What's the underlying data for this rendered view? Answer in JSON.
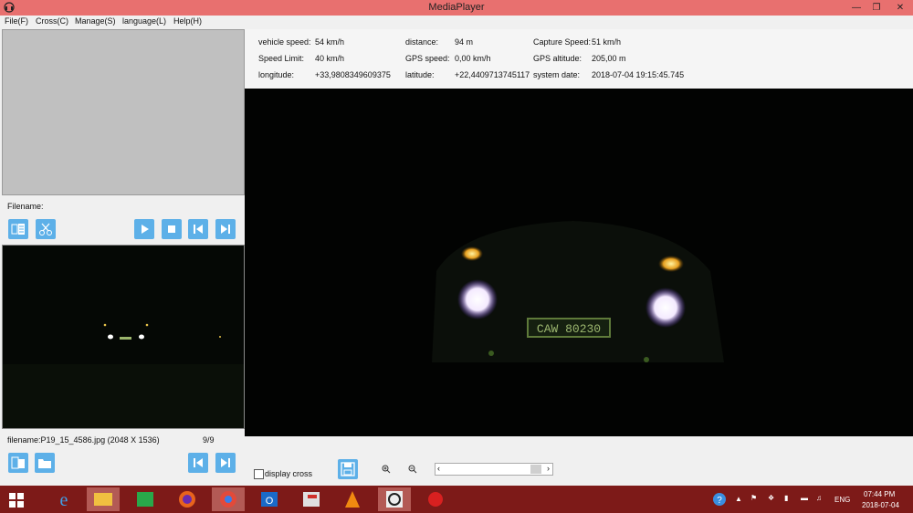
{
  "window": {
    "title": "MediaPlayer"
  },
  "menu": [
    "File(F)",
    "Cross(C)",
    "Manage(S)",
    "language(L)",
    "Help(H)"
  ],
  "left": {
    "filename_label": "Filename:",
    "file_info": "filename:P19_15_4586.jpg (2048 X 1536)",
    "counter": "9/9"
  },
  "info": {
    "vehicle_speed_label": "vehicle speed:",
    "vehicle_speed": "54 km/h",
    "distance_label": "distance:",
    "distance": "94 m",
    "capture_speed_label": "Capture Speed:",
    "capture_speed": "51 km/h",
    "speed_limit_label": "Speed Limit:",
    "speed_limit": "40 km/h",
    "gps_speed_label": "GPS speed:",
    "gps_speed": "0,00 km/h",
    "gps_altitude_label": "GPS altitude:",
    "gps_altitude": "205,00 m",
    "longitude_label": "longitude:",
    "longitude": "+33,9808349609375",
    "latitude_label": "latitude:",
    "latitude": "+22,4409713745117",
    "system_date_label": "system date:",
    "system_date": "2018-07-04 19:15:45.745"
  },
  "video": {
    "plate": "CAW 80230"
  },
  "bottom": {
    "display_cross_label": "display cross"
  },
  "taskbar": {
    "lang": "ENG",
    "time": "07:44 PM",
    "date": "2018-07-04"
  },
  "colors": {
    "titlebar": "#e8706f",
    "button": "#5db0e8",
    "taskbar": "#7d1a18"
  }
}
